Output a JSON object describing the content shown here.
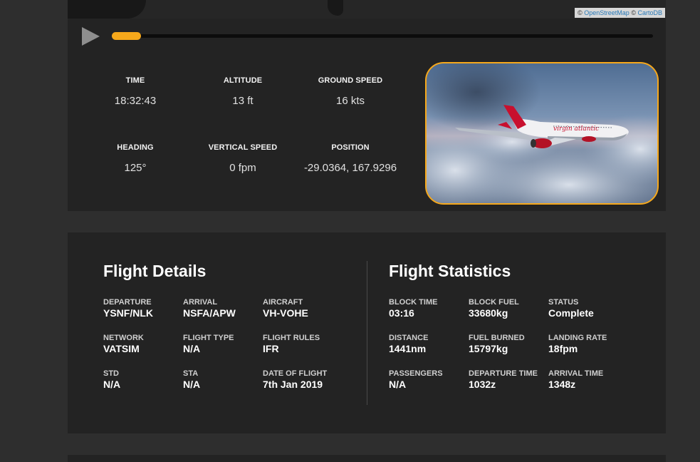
{
  "map": {
    "attribution_prefix": "©",
    "osm_link": "OpenStreetMap",
    "attribution_sep": "©",
    "carto_link": "CartoDB"
  },
  "player": {
    "progress_fraction": 0.054,
    "accent_color": "#f6a81b"
  },
  "telemetry": {
    "time": {
      "label": "TIME",
      "value": "18:32:43"
    },
    "altitude": {
      "label": "ALTITUDE",
      "value": "13 ft"
    },
    "ground_speed": {
      "label": "GROUND SPEED",
      "value": "16 kts"
    },
    "heading": {
      "label": "HEADING",
      "value": "125°"
    },
    "vertical_speed": {
      "label": "VERTICAL SPEED",
      "value": "0 fpm"
    },
    "position": {
      "label": "POSITION",
      "value": "-29.0364, 167.9296"
    }
  },
  "photo": {
    "livery_text": "virgin atlantic"
  },
  "flight_details": {
    "title": "Flight Details",
    "fields": [
      {
        "label": "DEPARTURE",
        "value": "YSNF/NLK"
      },
      {
        "label": "ARRIVAL",
        "value": "NSFA/APW"
      },
      {
        "label": "AIRCRAFT",
        "value": "VH-VOHE"
      },
      {
        "label": "NETWORK",
        "value": "VATSIM"
      },
      {
        "label": "FLIGHT TYPE",
        "value": "N/A"
      },
      {
        "label": "FLIGHT RULES",
        "value": "IFR"
      },
      {
        "label": "STD",
        "value": "N/A"
      },
      {
        "label": "STA",
        "value": "N/A"
      },
      {
        "label": "DATE OF FLIGHT",
        "value": "7th Jan 2019"
      }
    ]
  },
  "flight_statistics": {
    "title": "Flight Statistics",
    "fields": [
      {
        "label": "BLOCK TIME",
        "value": "03:16"
      },
      {
        "label": "BLOCK FUEL",
        "value": "33680kg"
      },
      {
        "label": "STATUS",
        "value": "Complete"
      },
      {
        "label": "DISTANCE",
        "value": "1441nm"
      },
      {
        "label": "FUEL BURNED",
        "value": "15797kg"
      },
      {
        "label": "LANDING RATE",
        "value": "18fpm"
      },
      {
        "label": "PASSENGERS",
        "value": "N/A"
      },
      {
        "label": "DEPARTURE TIME",
        "value": "1032z"
      },
      {
        "label": "ARRIVAL TIME",
        "value": "1348z"
      }
    ]
  }
}
